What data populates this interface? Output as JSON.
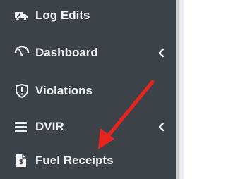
{
  "sidebar": {
    "items": [
      {
        "label": "Log Edits",
        "icon": "truck-pencil-icon",
        "has_submenu": false
      },
      {
        "label": "Dashboard",
        "icon": "speedometer-icon",
        "has_submenu": true
      },
      {
        "label": "Violations",
        "icon": "shield-alert-icon",
        "has_submenu": false
      },
      {
        "label": "DVIR",
        "icon": "menu-bars-icon",
        "has_submenu": true
      },
      {
        "label": "Fuel Receipts",
        "icon": "receipt-dollar-icon",
        "has_submenu": false
      }
    ]
  },
  "annotation": {
    "arrow_color": "#e8241f",
    "points_to": "Fuel Receipts"
  },
  "colors": {
    "sidebar_bg": "#3d4148",
    "text": "#f2f3f5",
    "gutter": "#c9ccd1"
  }
}
